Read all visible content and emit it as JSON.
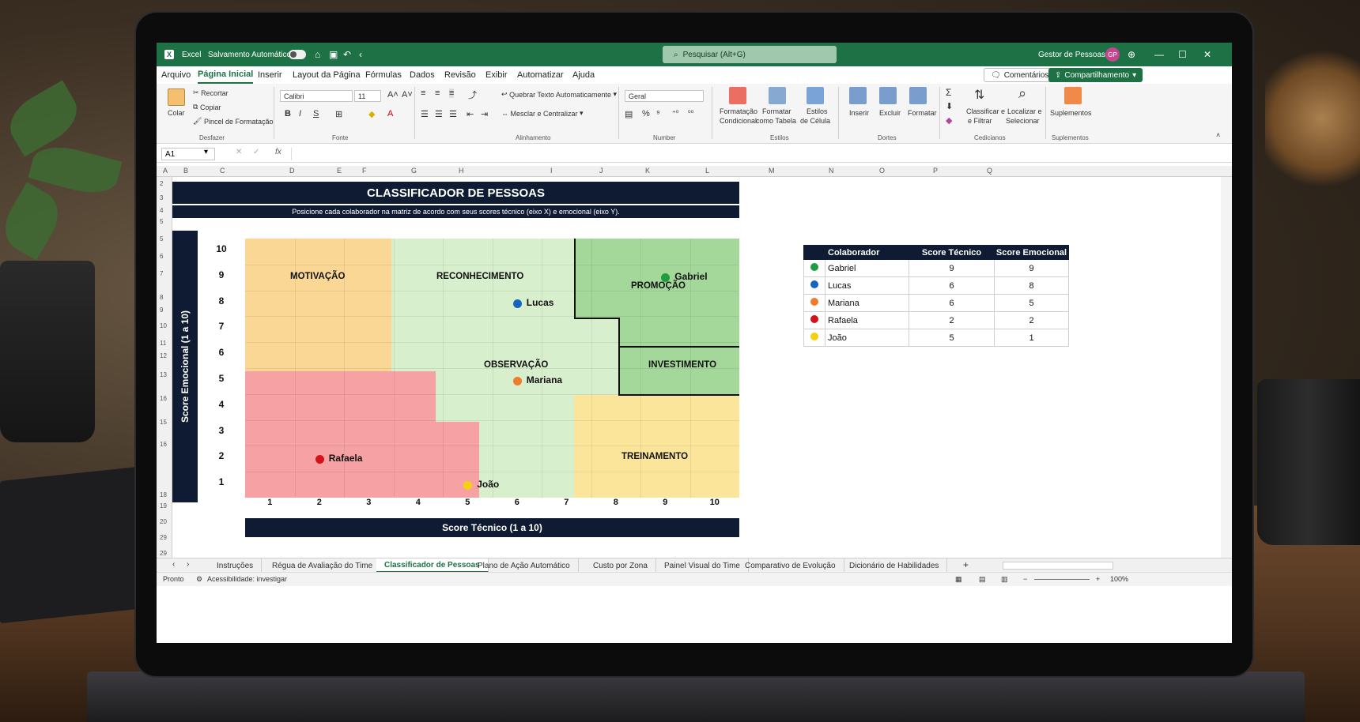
{
  "titlebar": {
    "app_name": "Excel",
    "autosave_label": "Salvamento Automático",
    "search_placeholder": "Pesquisar (Alt+G)",
    "user_name": "Gestor de Pessoas",
    "user_initials": "GP"
  },
  "menu": {
    "items": [
      "Arquivo",
      "Página Inicial",
      "Inserir",
      "Layout da Página",
      "Fórmulas",
      "Dados",
      "Revisão",
      "Exibir",
      "Automatizar",
      "Ajuda"
    ],
    "comments_label": "Comentários",
    "share_label": "Compartilhamento"
  },
  "ribbon": {
    "paste_label": "Colar",
    "cut_label": "Recortar",
    "copy_label": "Copiar",
    "format_painter_label": "Pincel de Formatação",
    "clipboard_group": "Desfazer",
    "font_name": "Calibri",
    "font_size": "11",
    "bold": "B",
    "italic": "I",
    "underline": "S",
    "font_group": "Fonte",
    "wrap_text_label": "Quebrar Texto Automaticamente",
    "merge_center_label": "Mesclar e Centralizar",
    "alignment_group": "Alinhamento",
    "number_format": "Geral",
    "number_group": "Number",
    "cond_format_label1": "Formatação",
    "cond_format_label2": "Condicional",
    "format_table_label1": "Formatar",
    "format_table_label2": "como Tabela",
    "cell_styles_label1": "Estilos",
    "cell_styles_label2": "de Célula",
    "styles_group": "Estilos",
    "insert_label": "Inserir",
    "delete_label": "Excluir",
    "format_label": "Formatar",
    "cells_group": "Dortes",
    "sort_filter_label1": "Classificar e",
    "sort_filter_label2": "e Filtrar",
    "find_select_label1": "Localizar e",
    "find_select_label2": "Selecionar",
    "editing_group": "Cedicianos",
    "addins_label": "Suplementos",
    "addins_group": "Suplementos"
  },
  "formula_bar": {
    "name_box": "A1",
    "fx": "fx",
    "formula": ""
  },
  "columns": [
    "A",
    "B",
    "C",
    "D",
    "E",
    "F",
    "G",
    "H",
    "I",
    "J",
    "K",
    "L",
    "M",
    "N",
    "O",
    "P",
    "Q"
  ],
  "rows": [
    "2",
    "3",
    "4",
    "5",
    "5",
    "6",
    "7",
    "8",
    "9",
    "10",
    "11",
    "12",
    "13",
    "16",
    "15",
    "16",
    "18",
    "19",
    "20",
    "29",
    "29"
  ],
  "sheet": {
    "title": "CLASSIFICADOR DE PESSOAS",
    "subtitle": "Posicione cada colaborador na matriz de acordo com seus scores técnico (eixo X) e emocional (eixo Y).",
    "y_axis_label": "Score Emocional (1 a 10)",
    "x_axis_label": "Score Técnico (1 a 10)",
    "y_ticks": [
      "10",
      "9",
      "8",
      "7",
      "6",
      "5",
      "4",
      "3",
      "2",
      "1"
    ],
    "x_ticks": [
      "1",
      "2",
      "3",
      "4",
      "5",
      "6",
      "7",
      "8",
      "9",
      "10"
    ],
    "zones": {
      "motivacao": "MOTIVAÇÃO",
      "reconhecimento": "RECONHECIMENTO",
      "promocao": "PROMOÇÃO",
      "observacao": "OBSERVAÇÃO",
      "investimento": "INVESTIMENTO",
      "treinamento": "TREINAMENTO"
    },
    "zone_colors": {
      "motivacao": "#fbd796",
      "reconhecimento": "#d7efcc",
      "promocao": "#a4d89a",
      "observacao": "#d7efcc",
      "investimento": "#a4d89a",
      "treinamento": "#fbe59a",
      "desenvolvimento": "#f6a1a3"
    }
  },
  "chart_data": {
    "type": "scatter",
    "xlabel": "Score Técnico (1 a 10)",
    "ylabel": "Score Emocional (1 a 10)",
    "xlim": [
      1,
      10
    ],
    "ylim": [
      1,
      10
    ],
    "points": [
      {
        "name": "Gabriel",
        "x": 9,
        "y": 9,
        "color": "#1e9c3f"
      },
      {
        "name": "Lucas",
        "x": 6,
        "y": 8,
        "color": "#1565c0"
      },
      {
        "name": "Mariana",
        "x": 6,
        "y": 5,
        "color": "#f07c2b"
      },
      {
        "name": "Rafaela",
        "x": 2,
        "y": 2,
        "color": "#d3121a"
      },
      {
        "name": "João",
        "x": 5,
        "y": 1,
        "color": "#f4d10f"
      }
    ]
  },
  "table": {
    "headers": [
      "",
      "Colaborador",
      "Score Técnico",
      "Score Emocional"
    ],
    "rows": [
      {
        "name": "Gabriel",
        "tec": "9",
        "emo": "9",
        "color": "#1e9c3f"
      },
      {
        "name": "Lucas",
        "tec": "6",
        "emo": "8",
        "color": "#1565c0"
      },
      {
        "name": "Mariana",
        "tec": "6",
        "emo": "5",
        "color": "#f07c2b"
      },
      {
        "name": "Rafaela",
        "tec": "2",
        "emo": "2",
        "color": "#d3121a"
      },
      {
        "name": "João",
        "tec": "5",
        "emo": "1",
        "color": "#f4d10f"
      }
    ]
  },
  "tabs": [
    "Instruções",
    "Régua de Avaliação do Time",
    "Classificador de Pessoas",
    "Plano de Ação Automático",
    "Custo por Zona",
    "Painel Visual do Time",
    "Comparativo de Evolução",
    "Dicionário de Habilidades"
  ],
  "active_tab": "Classificador de Pessoas",
  "status": {
    "ready": "Pronto",
    "accessibility": "Acessibilidade: investigar",
    "zoom": "100%"
  }
}
